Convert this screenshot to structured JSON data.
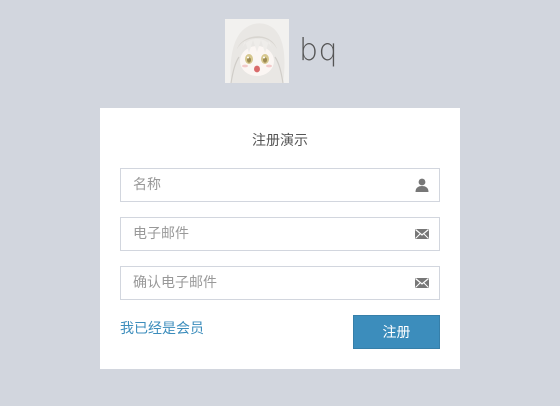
{
  "brand": {
    "name": "bq"
  },
  "form": {
    "title": "注册演示",
    "fields": [
      {
        "placeholder": "名称",
        "value": "",
        "icon": "user-icon"
      },
      {
        "placeholder": "电子邮件",
        "value": "",
        "icon": "envelope-icon"
      },
      {
        "placeholder": "确认电子邮件",
        "value": "",
        "icon": "envelope-icon"
      }
    ],
    "member_link": "我已经是会员",
    "submit_label": "注册"
  },
  "colors": {
    "background": "#d2d6de",
    "card": "#ffffff",
    "accent": "#3c8dbc"
  }
}
